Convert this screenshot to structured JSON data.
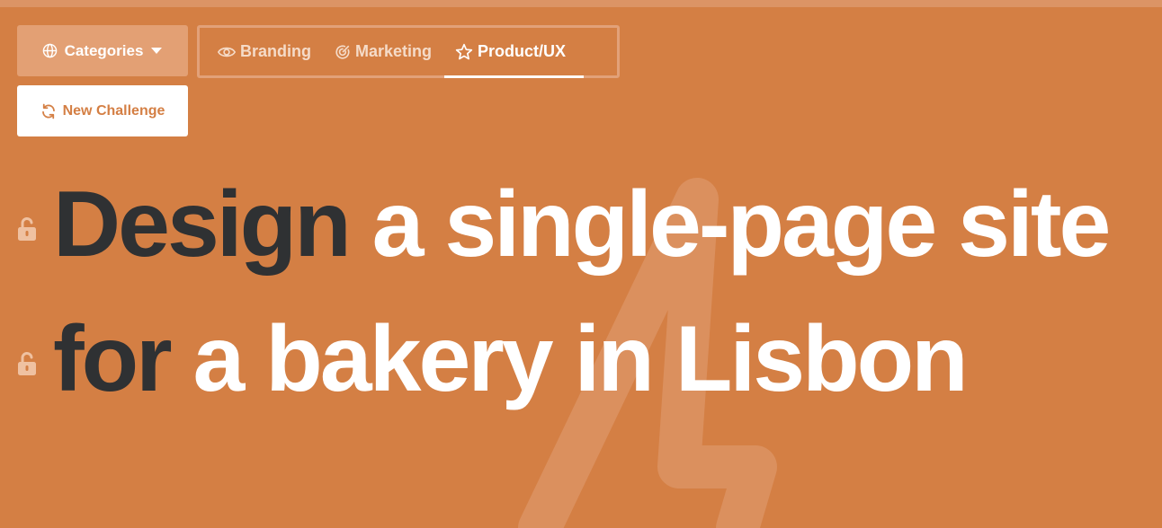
{
  "toolbar": {
    "categories_label": "Categories",
    "categories_icon": "globe-icon",
    "dropdown_icon": "caret-down-icon"
  },
  "tabs": [
    {
      "label": "Branding",
      "icon": "eye-icon",
      "active": false
    },
    {
      "label": "Marketing",
      "icon": "target-icon",
      "active": false
    },
    {
      "label": "Product/UX",
      "icon": "star-icon",
      "active": true
    }
  ],
  "actions": {
    "new_challenge_label": "New Challenge",
    "new_challenge_icon": "refresh-icon"
  },
  "challenge": {
    "line1": {
      "verb": "Design",
      "rest": "a single-page site"
    },
    "line2": {
      "verb": "for",
      "rest": "a bakery in Lisbon"
    },
    "lock_icon": "unlock-icon"
  },
  "colors": {
    "background": "#d47f44",
    "accent_text": "#2f3133",
    "text": "#ffffff"
  }
}
